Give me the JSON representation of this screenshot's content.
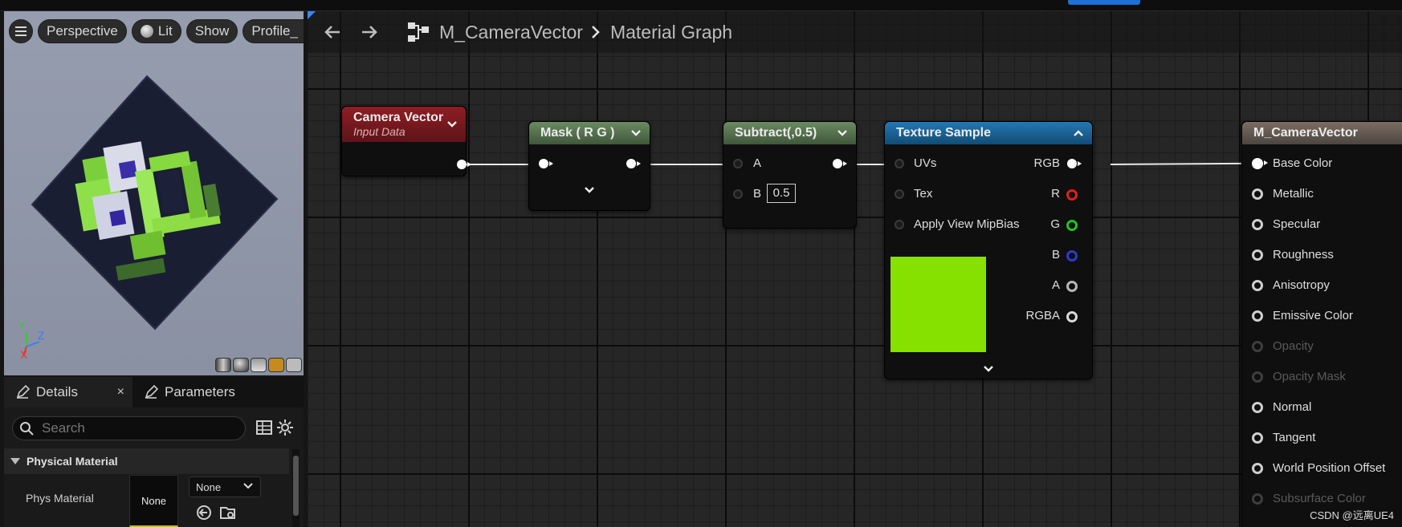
{
  "viewport": {
    "toolbar": {
      "perspective": "Perspective",
      "lit": "Lit",
      "show": "Show",
      "profile": "Profile_"
    },
    "axes": {
      "y": "Y",
      "z": "Z",
      "x": "X"
    }
  },
  "details": {
    "tab_details": "Details",
    "tab_parameters": "Parameters",
    "close_glyph": "×",
    "search_placeholder": "Search",
    "category": "Physical Material",
    "phys_material_label": "Phys Material",
    "thumbnail_text": "None",
    "combo_value": "None"
  },
  "graph": {
    "asset_name": "M_CameraVector",
    "breadcrumb_leaf": "Material Graph",
    "nodes": {
      "camera_vector": {
        "title": "Camera Vector",
        "subtitle": "Input Data",
        "header_color": "#8a1f23"
      },
      "mask": {
        "title": "Mask ( R G )",
        "header_color": "#5c7a54"
      },
      "subtract": {
        "title": "Subtract(,0.5)",
        "a": "A",
        "b": "B",
        "b_value": "0.5",
        "header_color": "#5c7a54"
      },
      "texture_sample": {
        "title": "Texture Sample",
        "header_color": "#1d6aa0",
        "inputs": [
          "UVs",
          "Tex",
          "Apply View MipBias"
        ],
        "outputs": [
          {
            "label": "RGB",
            "color": "#ffffff"
          },
          {
            "label": "R",
            "color": "#e02020"
          },
          {
            "label": "G",
            "color": "#22c522"
          },
          {
            "label": "B",
            "color": "#2b3dcf"
          },
          {
            "label": "A",
            "color": "#b8b8b8"
          },
          {
            "label": "RGBA",
            "color": "#d8d8d8"
          }
        ],
        "preview_color": "#86e000"
      },
      "material_output": {
        "title": "M_CameraVector",
        "header_color": "#6c6156",
        "inputs": [
          {
            "label": "Base Color",
            "enabled": true
          },
          {
            "label": "Metallic",
            "enabled": true
          },
          {
            "label": "Specular",
            "enabled": true
          },
          {
            "label": "Roughness",
            "enabled": true
          },
          {
            "label": "Anisotropy",
            "enabled": true
          },
          {
            "label": "Emissive Color",
            "enabled": true
          },
          {
            "label": "Opacity",
            "enabled": false
          },
          {
            "label": "Opacity Mask",
            "enabled": false
          },
          {
            "label": "Normal",
            "enabled": true
          },
          {
            "label": "Tangent",
            "enabled": true
          },
          {
            "label": "World Position Offset",
            "enabled": true
          },
          {
            "label": "Subsurface Color",
            "enabled": false
          }
        ]
      }
    }
  },
  "watermark": "CSDN @远离UE4"
}
